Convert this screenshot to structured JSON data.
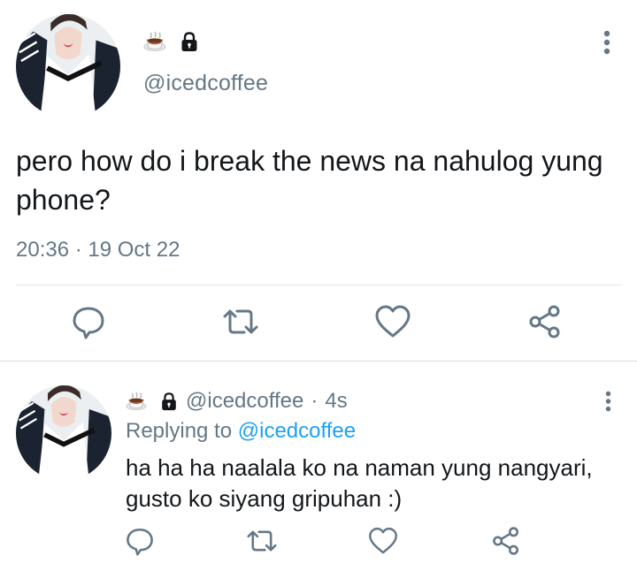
{
  "main_tweet": {
    "handle": "@icedcoffee",
    "display_icons": [
      "coffee-icon",
      "lock-icon"
    ],
    "text": "pero how do i break the news na nahulog yung phone?",
    "timestamp": "20:36 · 19 Oct 22",
    "actions": [
      "reply-icon",
      "retweet-icon",
      "like-icon",
      "share-icon"
    ]
  },
  "reply_tweet": {
    "handle": "@icedcoffee",
    "separator": "·",
    "age": "4s",
    "replying_prefix": "Replying to",
    "replying_to": "@icedcoffee",
    "text": "ha ha ha naalala ko na naman yung nangyari, gusto ko siyang gripuhan :)",
    "actions": [
      "reply-icon",
      "retweet-icon",
      "like-icon",
      "share-icon"
    ]
  },
  "colors": {
    "text_primary": "#14171a",
    "text_secondary": "#657786",
    "link": "#1da1f2",
    "divider": "#e1e8ed"
  }
}
